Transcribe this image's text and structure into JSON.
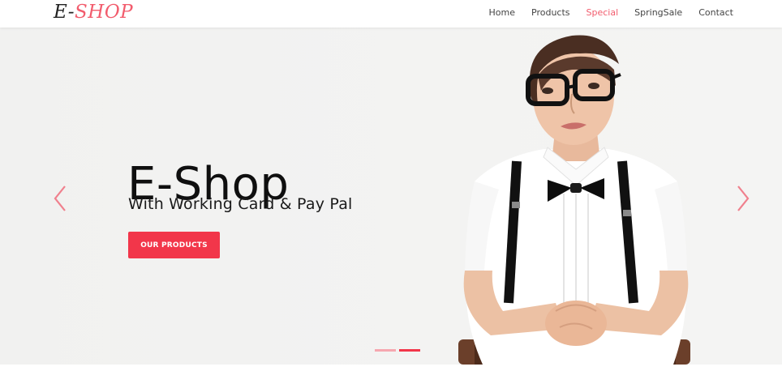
{
  "brand": {
    "logo_left": "E",
    "logo_dash": "-",
    "logo_right": "SHOP"
  },
  "nav": {
    "items": [
      {
        "label": "Home",
        "active": false
      },
      {
        "label": "Products",
        "active": false
      },
      {
        "label": "Special",
        "active": true
      },
      {
        "label": "SpringSale",
        "active": false
      },
      {
        "label": "Contact",
        "active": false
      }
    ]
  },
  "hero": {
    "title": "E-Shop",
    "subtitle": "With Working Card & Pay Pal",
    "cta_label": "OUR PRODUCTS",
    "slides_count": 2,
    "active_slide": 2
  },
  "icons": {
    "prev": "chevron-left-icon",
    "next": "chevron-right-icon"
  },
  "colors": {
    "accent": "#f2364a",
    "accent_light": "#f25c6d",
    "hero_bg": "#f1f1f0"
  }
}
